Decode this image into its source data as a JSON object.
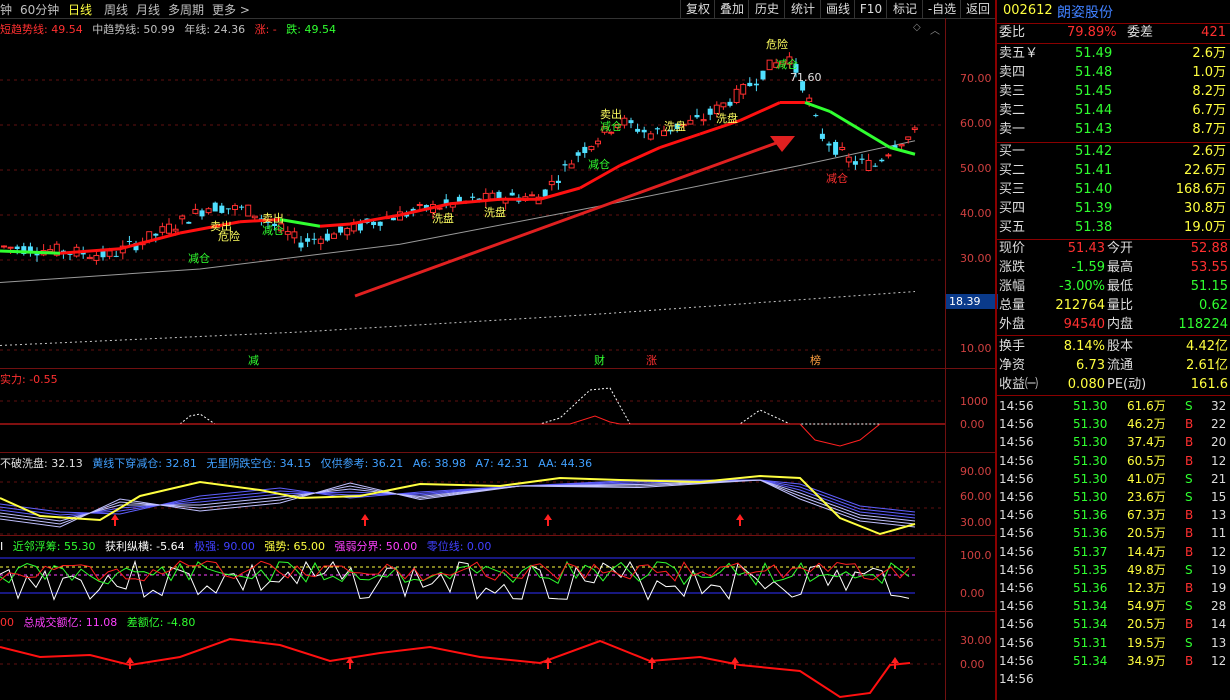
{
  "periods": [
    {
      "label": "钟",
      "active": false
    },
    {
      "label": "60分钟",
      "active": false
    },
    {
      "label": "日线",
      "active": true
    },
    {
      "label": "周线",
      "active": false
    },
    {
      "label": "月线",
      "active": false
    },
    {
      "label": "多周期",
      "active": false
    },
    {
      "label": "更多 >",
      "active": false
    }
  ],
  "toolbar": [
    "复权",
    "叠加",
    "历史",
    "统计",
    "画线",
    "F10",
    "标记",
    "-自选",
    "返回"
  ],
  "main_legend": [
    {
      "label": "短趋势线: 49.54",
      "color": "#ff3030"
    },
    {
      "label": "中趋势线: 50.99",
      "color": "#c0c0c0"
    },
    {
      "label": "年线: 24.36",
      "color": "#c0c0c0"
    },
    {
      "label": "涨: -",
      "color": "#ff3030"
    },
    {
      "label": "跌: 49.54",
      "color": "#30ff30"
    }
  ],
  "main_axis": [
    "70.00",
    "60.00",
    "50.00",
    "40.00",
    "30.00",
    "10.00"
  ],
  "price_tag": "18.39",
  "annotations": {
    "high": "71.60",
    "danger": "危险",
    "reduce": "减仓",
    "sell": "卖出",
    "wash": "洗盘",
    "markers": [
      "减",
      "财",
      "涨",
      "榜"
    ]
  },
  "panel2": {
    "legend": "实力: -0.55",
    "axis": [
      "1000",
      "0.00"
    ]
  },
  "panel3": {
    "legend": [
      {
        "label": "不破洗盘: 32.13",
        "color": "#e0e0e0"
      },
      {
        "label": "黄线下穿减仓: 32.81",
        "color": "#40a0ff"
      },
      {
        "label": "无里阴跌空仓: 34.15",
        "color": "#40a0ff"
      },
      {
        "label": "仅供参考: 36.21",
        "color": "#40a0ff"
      },
      {
        "label": "A6: 38.98",
        "color": "#40a0ff"
      },
      {
        "label": "A7: 42.31",
        "color": "#40a0ff"
      },
      {
        "label": "AA: 44.36",
        "color": "#40a0ff"
      }
    ],
    "axis": [
      "90.00",
      "60.00",
      "30.00"
    ]
  },
  "panel4": {
    "legend": [
      {
        "label": "I",
        "color": "#ffffff"
      },
      {
        "label": "近邻浮筹: 55.30",
        "color": "#30ff30"
      },
      {
        "label": "获利纵横: -5.64",
        "color": "#ffffff"
      },
      {
        "label": "极强: 90.00",
        "color": "#4040ff"
      },
      {
        "label": "强势: 65.00",
        "color": "#ffff40"
      },
      {
        "label": "强弱分界: 50.00",
        "color": "#ff40ff"
      },
      {
        "label": "零位线: 0.00",
        "color": "#4040ff"
      }
    ],
    "axis": [
      "100.0",
      "0.00"
    ]
  },
  "panel5": {
    "legend": [
      {
        "label": "00",
        "color": "#ff3030"
      },
      {
        "label": "总成交额亿: 11.08",
        "color": "#ff40ff"
      },
      {
        "label": "差额亿: -4.80",
        "color": "#30ff30"
      }
    ],
    "axis": [
      "30.00",
      "0.00"
    ]
  },
  "stock": {
    "code": "002612",
    "name": "朗姿股份"
  },
  "quote_head": {
    "wb_label": "委比",
    "wb_value": "79.89%",
    "wc_label": "委差",
    "wc_value": "421"
  },
  "asks": [
    {
      "label": "卖五￥",
      "price": "51.49",
      "vol": "2.6万"
    },
    {
      "label": "卖四",
      "price": "51.48",
      "vol": "1.0万"
    },
    {
      "label": "卖三",
      "price": "51.45",
      "vol": "8.2万"
    },
    {
      "label": "卖二",
      "price": "51.44",
      "vol": "6.7万"
    },
    {
      "label": "卖一",
      "price": "51.43",
      "vol": "8.7万"
    }
  ],
  "bids": [
    {
      "label": "买一",
      "price": "51.42",
      "vol": "2.6万"
    },
    {
      "label": "买二",
      "price": "51.41",
      "vol": "22.6万"
    },
    {
      "label": "买三",
      "price": "51.40",
      "vol": "168.6万"
    },
    {
      "label": "买四",
      "price": "51.39",
      "vol": "30.8万"
    },
    {
      "label": "买五",
      "price": "51.38",
      "vol": "19.0万"
    }
  ],
  "stats": [
    {
      "l1": "现价",
      "v1": "51.43",
      "c1": "#ff3030",
      "l2": "今开",
      "v2": "52.88",
      "c2": "#ff3030"
    },
    {
      "l1": "涨跌",
      "v1": "-1.59",
      "c1": "#30ff30",
      "l2": "最高",
      "v2": "53.55",
      "c2": "#ff3030"
    },
    {
      "l1": "涨幅",
      "v1": "-3.00%",
      "c1": "#30ff30",
      "l2": "最低",
      "v2": "51.15",
      "c2": "#30ff30"
    },
    {
      "l1": "总量",
      "v1": "212764",
      "c1": "#ffff40",
      "l2": "量比",
      "v2": "0.62",
      "c2": "#30ff30"
    },
    {
      "l1": "外盘",
      "v1": "94540",
      "c1": "#ff3030",
      "l2": "内盘",
      "v2": "118224",
      "c2": "#30ff30"
    },
    {
      "l1": "换手",
      "v1": "8.14%",
      "c1": "#ffff40",
      "l2": "股本",
      "v2": "4.42亿",
      "c2": "#ffff40"
    },
    {
      "l1": "净资",
      "v1": "6.73",
      "c1": "#ffff40",
      "l2": "流通",
      "v2": "2.61亿",
      "c2": "#ffff40"
    },
    {
      "l1": "收益㈠",
      "v1": "0.080",
      "c1": "#ffff40",
      "l2": "PE(动)",
      "v2": "161.6",
      "c2": "#ffff40"
    }
  ],
  "ticks": [
    {
      "time": "14:56",
      "price": "51.30",
      "vol": "61.6万",
      "bs": "S",
      "n": "32"
    },
    {
      "time": "14:56",
      "price": "51.30",
      "vol": "46.2万",
      "bs": "B",
      "n": "22"
    },
    {
      "time": "14:56",
      "price": "51.30",
      "vol": "37.4万",
      "bs": "B",
      "n": "20"
    },
    {
      "time": "14:56",
      "price": "51.30",
      "vol": "60.5万",
      "bs": "B",
      "n": "12"
    },
    {
      "time": "14:56",
      "price": "51.30",
      "vol": "41.0万",
      "bs": "S",
      "n": "21"
    },
    {
      "time": "14:56",
      "price": "51.30",
      "vol": "23.6万",
      "bs": "S",
      "n": "15"
    },
    {
      "time": "14:56",
      "price": "51.36",
      "vol": "67.3万",
      "bs": "B",
      "n": "13"
    },
    {
      "time": "14:56",
      "price": "51.36",
      "vol": "20.5万",
      "bs": "B",
      "n": "11"
    },
    {
      "time": "14:56",
      "price": "51.37",
      "vol": "14.4万",
      "bs": "B",
      "n": "12"
    },
    {
      "time": "14:56",
      "price": "51.35",
      "vol": "49.8万",
      "bs": "S",
      "n": "19"
    },
    {
      "time": "14:56",
      "price": "51.36",
      "vol": "12.3万",
      "bs": "B",
      "n": "19"
    },
    {
      "time": "14:56",
      "price": "51.34",
      "vol": "54.9万",
      "bs": "S",
      "n": "28"
    },
    {
      "time": "14:56",
      "price": "51.34",
      "vol": "20.5万",
      "bs": "B",
      "n": "14"
    },
    {
      "time": "14:56",
      "price": "51.31",
      "vol": "19.5万",
      "bs": "S",
      "n": "13"
    },
    {
      "time": "14:56",
      "price": "51.34",
      "vol": "34.9万",
      "bs": "B",
      "n": "12"
    },
    {
      "time": "14:56",
      "price": "",
      "vol": "",
      "bs": "",
      "n": ""
    }
  ]
}
